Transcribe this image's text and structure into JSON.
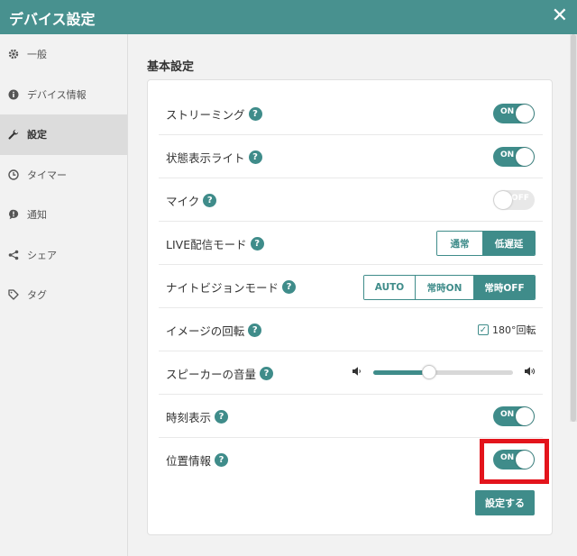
{
  "window": {
    "title": "デバイス設定",
    "close_icon": "close-icon"
  },
  "sidebar": {
    "items": [
      {
        "label": "一般",
        "icon": "gear-icon",
        "active": false
      },
      {
        "label": "デバイス情報",
        "icon": "info-icon",
        "active": false
      },
      {
        "label": "設定",
        "icon": "wrench-icon",
        "active": true
      },
      {
        "label": "タイマー",
        "icon": "clock-icon",
        "active": false
      },
      {
        "label": "通知",
        "icon": "notification-icon",
        "active": false
      },
      {
        "label": "シェア",
        "icon": "share-icon",
        "active": false
      },
      {
        "label": "タグ",
        "icon": "tag-icon",
        "active": false
      }
    ]
  },
  "main": {
    "section_title": "基本設定",
    "rows": {
      "streaming": {
        "label": "ストリーミング",
        "toggle": "ON",
        "state": true
      },
      "status_light": {
        "label": "状態表示ライト",
        "toggle": "ON",
        "state": true
      },
      "mic": {
        "label": "マイク",
        "toggle": "OFF",
        "state": false
      },
      "live_mode": {
        "label": "LIVE配信モード",
        "options": [
          "通常",
          "低遅延"
        ],
        "selected": "低遅延"
      },
      "night_vision": {
        "label": "ナイトビジョンモード",
        "options": [
          "AUTO",
          "常時ON",
          "常時OFF"
        ],
        "selected": "常時OFF"
      },
      "image_rotation": {
        "label": "イメージの回転",
        "checkbox_label": "180°回転",
        "checked": true
      },
      "speaker_volume": {
        "label": "スピーカーの音量",
        "value_fraction": 0.4
      },
      "time_display": {
        "label": "時刻表示",
        "toggle": "ON",
        "state": true
      },
      "location": {
        "label": "位置情報",
        "toggle": "ON",
        "state": true
      }
    },
    "help_glyph": "?",
    "submit_label": "設定する"
  },
  "colors": {
    "accent": "#3f8c8a",
    "titlebar": "#48918f",
    "highlight": "#e3141c"
  }
}
